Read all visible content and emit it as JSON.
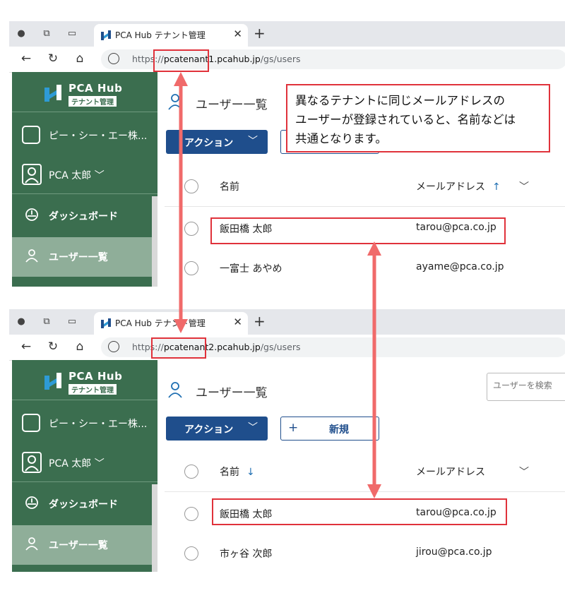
{
  "screens": [
    {
      "tab_title": "PCA Hub テナント管理",
      "url_prefix": "https://",
      "url_host": "pcatenant1.pcahub.jp",
      "url_path": "/gs/users",
      "logo_title": "PCA Hub",
      "logo_subtitle": "テナント管理",
      "company": "ピー・シー・エー株...",
      "user_name": "PCA 太郎",
      "user_chevron": "﹀",
      "menu": [
        "ダッシュボード",
        "ユーザー一覧"
      ],
      "page_title": "ユーザー一覧",
      "action_label": "アクション",
      "action_chevron": "﹀",
      "columns": {
        "name": "名前",
        "email": "メールアドレス",
        "sort_icon": "↑"
      },
      "rows": [
        {
          "name": "飯田橋 太郎",
          "email": "tarou@pca.co.jp"
        },
        {
          "name": "一富士 あやめ",
          "email": "ayame@pca.co.jp"
        }
      ]
    },
    {
      "tab_title": "PCA Hub テナント管理",
      "url_prefix": "https://",
      "url_host": "pcatenant2.pcahub.jp",
      "url_path": "/gs/users",
      "logo_title": "PCA Hub",
      "logo_subtitle": "テナント管理",
      "company": "ピー・シー・エー株...",
      "user_name": "PCA 太郎",
      "user_chevron": "﹀",
      "menu": [
        "ダッシュボード",
        "ユーザー一覧"
      ],
      "page_title": "ユーザー一覧",
      "action_label": "アクション",
      "action_chevron": "﹀",
      "new_label": "新規",
      "search_placeholder": "ユーザーを検索",
      "columns": {
        "name": "名前",
        "email": "メールアドレス",
        "sort_icon": "↓"
      },
      "rows": [
        {
          "name": "飯田橋 太郎",
          "email": "tarou@pca.co.jp"
        },
        {
          "name": "市ヶ谷 次郎",
          "email": "jirou@pca.co.jp"
        }
      ]
    }
  ],
  "callout": {
    "lines": [
      "異なるテナントに同じメールアドレスの",
      "ユーザーが登録されていると、名前などは",
      "共通となります。"
    ]
  },
  "colors": {
    "sidebar": "#3b6e4f",
    "primary_button": "#1f4e8c",
    "highlight": "#e0323b",
    "arrow": "#f06a6a"
  }
}
